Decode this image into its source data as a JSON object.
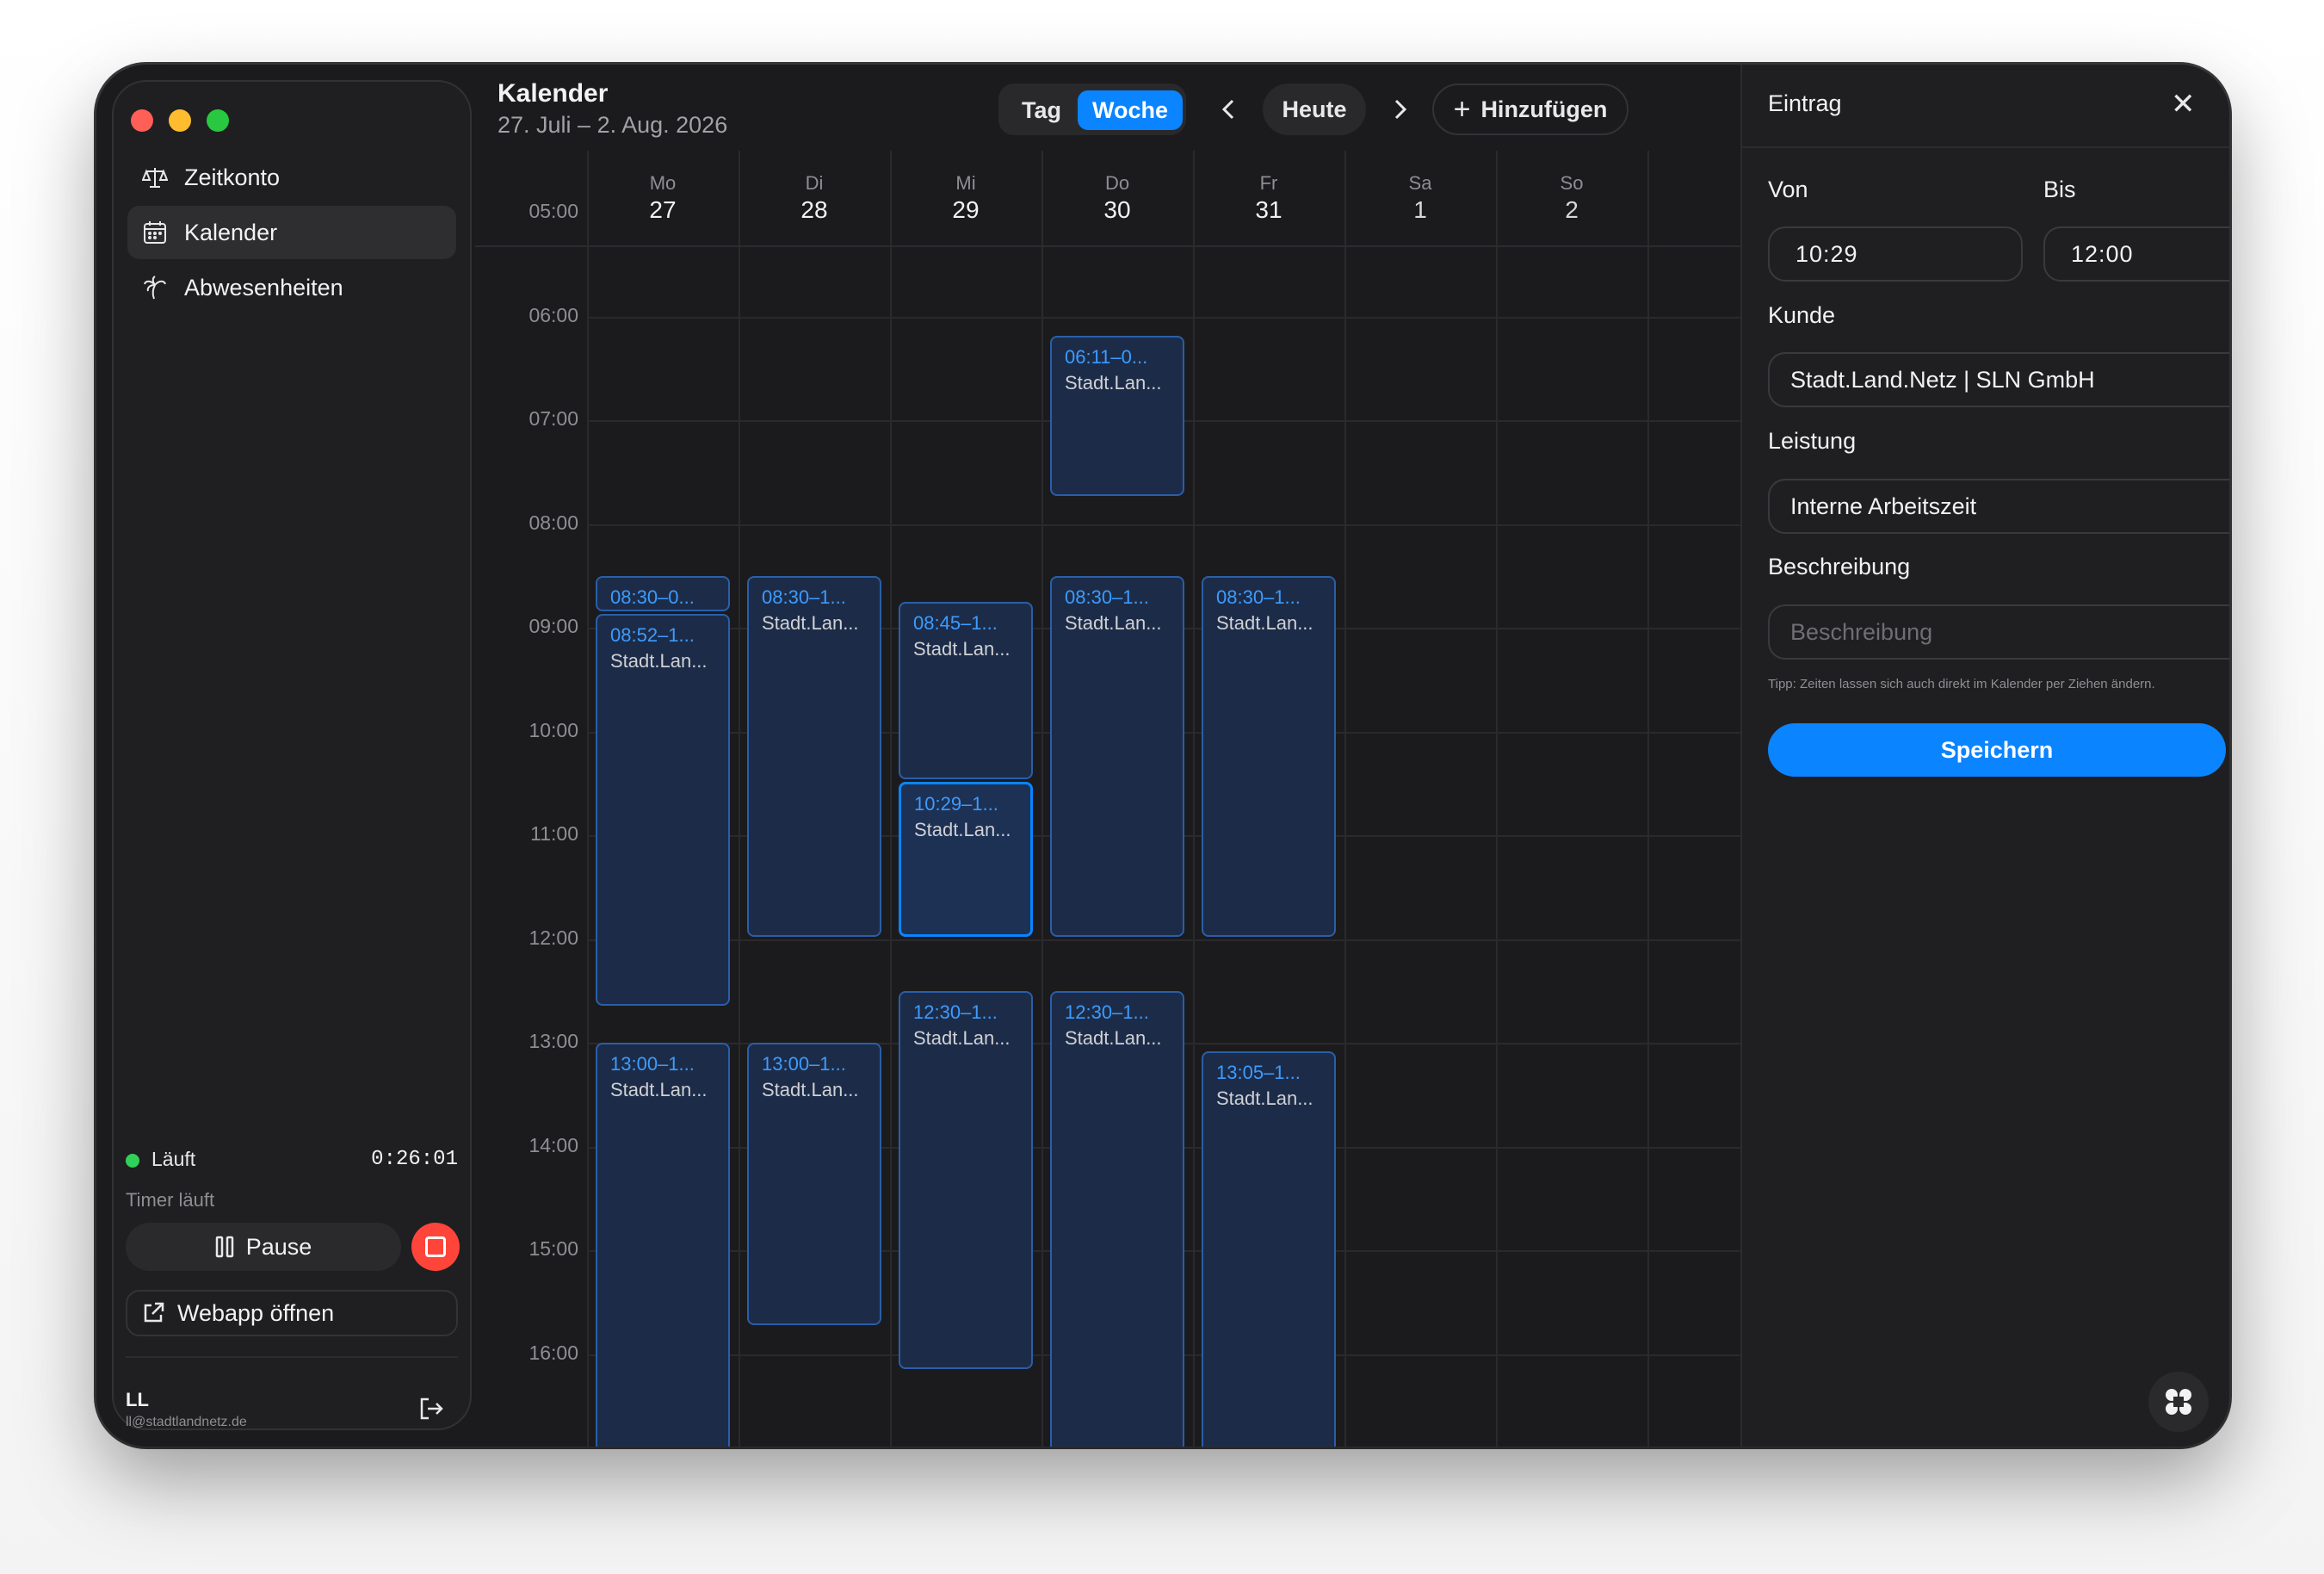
{
  "sidebar": {
    "nav": [
      {
        "label": "Zeitkonto",
        "icon": "scale-icon"
      },
      {
        "label": "Kalender",
        "icon": "calendar-icon"
      },
      {
        "label": "Abwesenheiten",
        "icon": "palm-tree-icon"
      }
    ],
    "status": "Läuft",
    "timer": "0:26:01",
    "timer_status": "Timer läuft",
    "pause_label": "Pause",
    "webapp_label": "Webapp öffnen",
    "user_initials": "LL",
    "user_email": "ll@stadtlandnetz.de"
  },
  "calendar": {
    "title": "Kalender",
    "range": "27. Juli – 2. Aug. 2026",
    "view_day": "Tag",
    "view_week": "Woche",
    "active_view": "Woche",
    "today_label": "Heute",
    "add_label": "Hinzufügen",
    "days": [
      {
        "name": "Mo",
        "date": "27"
      },
      {
        "name": "Di",
        "date": "28"
      },
      {
        "name": "Mi",
        "date": "29"
      },
      {
        "name": "Do",
        "date": "30"
      },
      {
        "name": "Fr",
        "date": "31"
      },
      {
        "name": "Sa",
        "date": "1"
      },
      {
        "name": "So",
        "date": "2"
      }
    ],
    "hours": [
      "05:00",
      "06:00",
      "07:00",
      "08:00",
      "09:00",
      "10:00",
      "11:00",
      "12:00",
      "13:00",
      "14:00",
      "15:00",
      "16:00"
    ],
    "events": [
      {
        "day": 0,
        "start": "08:30",
        "end": "08:52",
        "time_label": "08:30–0...",
        "client_label": ""
      },
      {
        "day": 0,
        "start": "08:52",
        "end": "12:40",
        "time_label": "08:52–1...",
        "client_label": "Stadt.Lan..."
      },
      {
        "day": 0,
        "start": "13:00",
        "end": "17:00",
        "time_label": "13:00–1...",
        "client_label": "Stadt.Lan..."
      },
      {
        "day": 1,
        "start": "08:30",
        "end": "12:00",
        "time_label": "08:30–1...",
        "client_label": "Stadt.Lan..."
      },
      {
        "day": 1,
        "start": "13:00",
        "end": "15:45",
        "time_label": "13:00–1...",
        "client_label": "Stadt.Lan..."
      },
      {
        "day": 2,
        "start": "08:45",
        "end": "10:29",
        "time_label": "08:45–1...",
        "client_label": "Stadt.Lan..."
      },
      {
        "day": 2,
        "start": "10:29",
        "end": "12:00",
        "time_label": "10:29–1...",
        "client_label": "Stadt.Lan...",
        "selected": true
      },
      {
        "day": 2,
        "start": "12:30",
        "end": "16:10",
        "time_label": "12:30–1...",
        "client_label": "Stadt.Lan..."
      },
      {
        "day": 3,
        "start": "06:11",
        "end": "07:45",
        "time_label": "06:11–0...",
        "client_label": "Stadt.Lan..."
      },
      {
        "day": 3,
        "start": "08:30",
        "end": "12:00",
        "time_label": "08:30–1...",
        "client_label": "Stadt.Lan..."
      },
      {
        "day": 3,
        "start": "12:30",
        "end": "17:00",
        "time_label": "12:30–1...",
        "client_label": "Stadt.Lan..."
      },
      {
        "day": 4,
        "start": "08:30",
        "end": "12:00",
        "time_label": "08:30–1...",
        "client_label": "Stadt.Lan..."
      },
      {
        "day": 4,
        "start": "13:05",
        "end": "17:00",
        "time_label": "13:05–1...",
        "client_label": "Stadt.Lan..."
      }
    ]
  },
  "entry": {
    "title": "Eintrag",
    "from_label": "Von",
    "from_value": "10:29",
    "to_label": "Bis",
    "to_value": "12:00",
    "client_label": "Kunde",
    "client_value": "Stadt.Land.Netz | SLN GmbH",
    "service_label": "Leistung",
    "service_value": "Interne Arbeitszeit",
    "description_label": "Beschreibung",
    "description_placeholder": "Beschreibung",
    "tip": "Tipp: Zeiten lassen sich auch direkt im Kalender per Ziehen ändern.",
    "save_label": "Speichern"
  },
  "colors": {
    "accent": "#0a84ff",
    "running": "#30d158",
    "stop": "#ff453a"
  }
}
